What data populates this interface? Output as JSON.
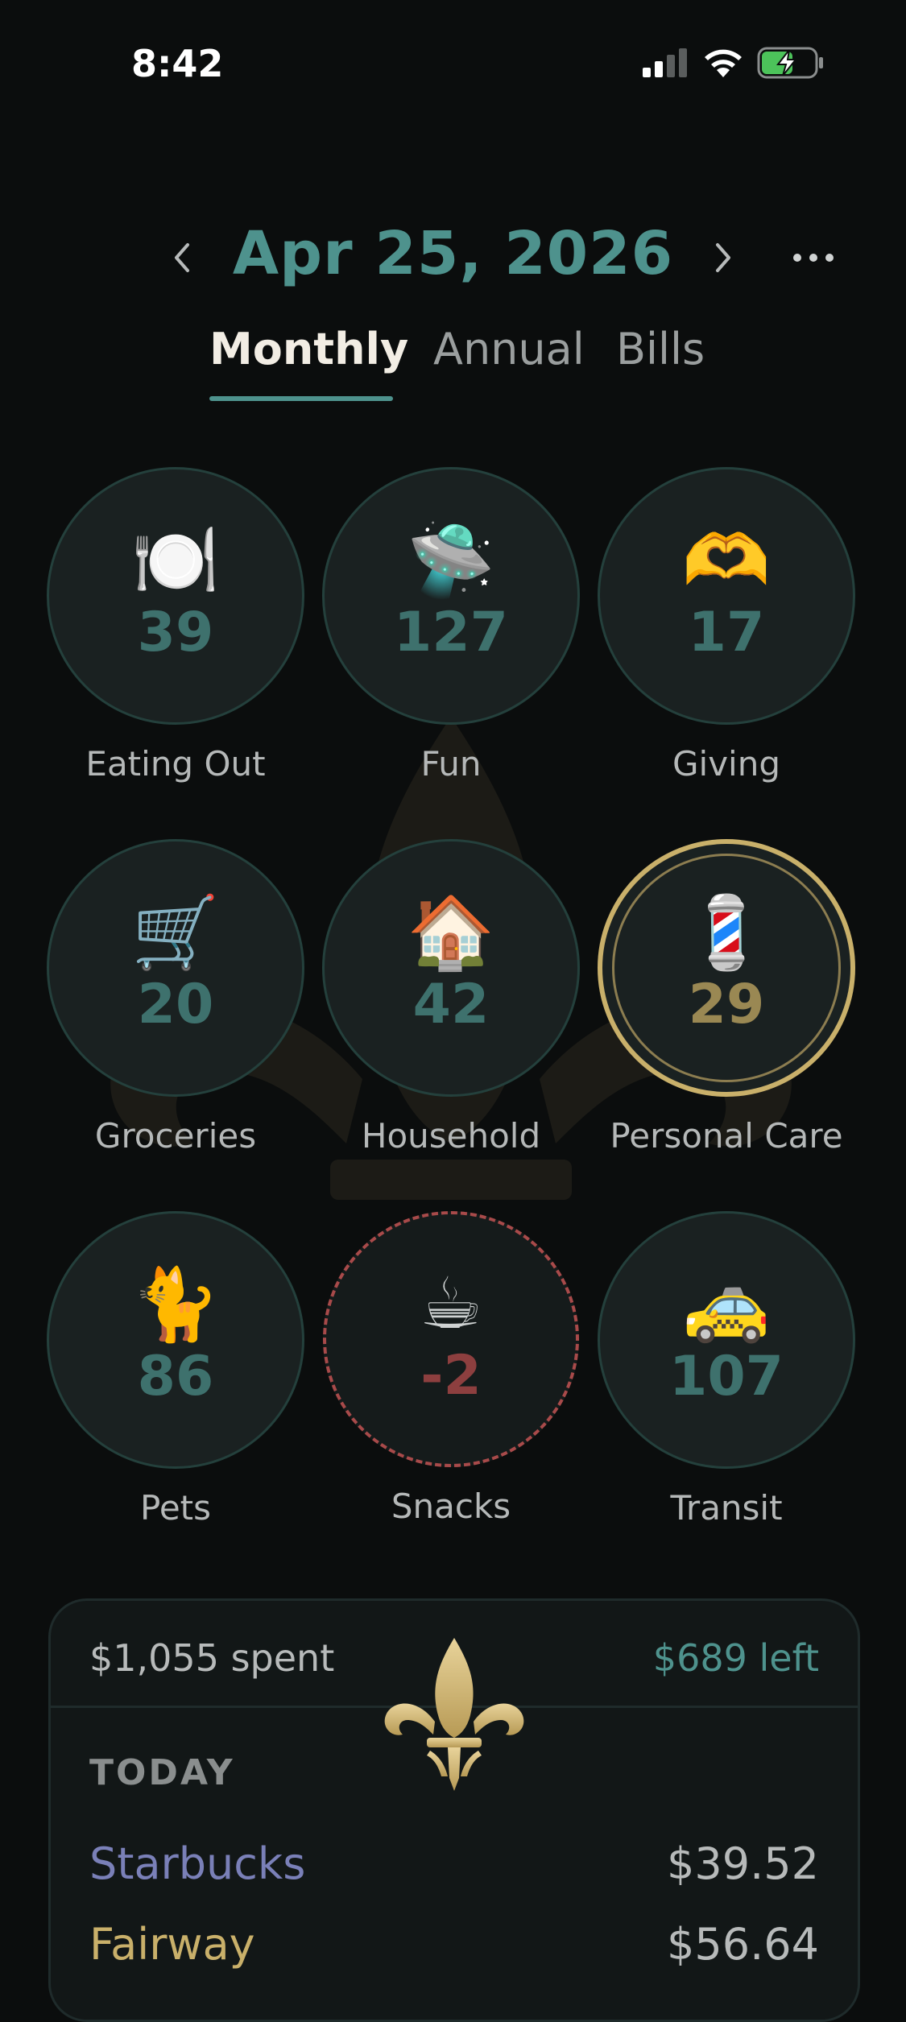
{
  "status_bar": {
    "time": "8:42"
  },
  "header": {
    "date": "Apr 25, 2026",
    "tabs": [
      {
        "label": "Monthly",
        "active": true
      },
      {
        "label": "Annual",
        "active": false
      },
      {
        "label": "Bills",
        "active": false
      }
    ]
  },
  "categories": [
    {
      "emoji": "🍽️",
      "value": "39",
      "label": "Eating Out"
    },
    {
      "emoji": "🛸",
      "value": "127",
      "label": "Fun"
    },
    {
      "emoji": "🫶",
      "value": "17",
      "label": "Giving"
    },
    {
      "emoji": "🛒",
      "value": "20",
      "label": "Groceries"
    },
    {
      "emoji": "🏠",
      "value": "42",
      "label": "Household"
    },
    {
      "emoji": "💈",
      "value": "29",
      "label": "Personal Care",
      "selected": true
    },
    {
      "emoji": "🐈",
      "value": "86",
      "label": "Pets"
    },
    {
      "emoji": "☕",
      "value": "-2",
      "label": "Snacks",
      "over_budget": true
    },
    {
      "emoji": "🚕",
      "value": "107",
      "label": "Transit"
    }
  ],
  "summary": {
    "spent": "$1,055 spent",
    "left": "$689 left",
    "section_header": "TODAY",
    "transactions": [
      {
        "merchant": "Starbucks",
        "amount": "$39.52",
        "color": "#7a80b8"
      },
      {
        "merchant": "Fairway",
        "amount": "$56.64",
        "color": "#c9b06a"
      }
    ]
  },
  "colors": {
    "accent": "#4e928d",
    "gold": "#c9b06a",
    "over_budget": "#a84a4a",
    "background": "#0b0d0d"
  }
}
